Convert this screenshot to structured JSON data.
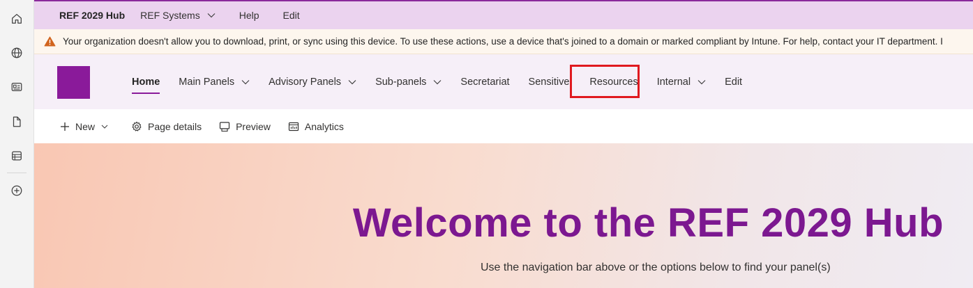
{
  "rail": {
    "icons": [
      "home-icon",
      "globe-icon",
      "news-icon",
      "document-icon",
      "list-icon",
      "add-icon"
    ]
  },
  "suite": {
    "site_title": "REF 2029 Hub",
    "items": [
      {
        "label": "REF Systems",
        "has_dropdown": true
      },
      {
        "label": "Help",
        "has_dropdown": false
      },
      {
        "label": "Edit",
        "has_dropdown": false
      }
    ]
  },
  "warning": {
    "text": "Your organization doesn't allow you to download, print, or sync using this device. To use these actions, use a device that's joined to a domain or marked compliant by Intune. For help, contact your IT department. I"
  },
  "nav": {
    "items": [
      {
        "label": "Home",
        "active": true
      },
      {
        "label": "Main Panels",
        "dropdown": true
      },
      {
        "label": "Advisory Panels",
        "dropdown": true
      },
      {
        "label": "Sub-panels",
        "dropdown": true
      },
      {
        "label": "Secretariat"
      },
      {
        "label": "Sensitive"
      },
      {
        "label": "Resources",
        "highlighted": true
      },
      {
        "label": "Internal",
        "dropdown": true
      },
      {
        "label": "Edit"
      }
    ]
  },
  "cmdbar": {
    "new_label": "New",
    "page_details_label": "Page details",
    "preview_label": "Preview",
    "analytics_label": "Analytics"
  },
  "hero": {
    "title": "Welcome to the REF 2029 Hub",
    "subtitle": "Use the navigation bar above or the options below to find your panel(s)"
  },
  "colors": {
    "brand": "#8a1a9a",
    "suite_bar": "#ebd3ef",
    "highlight_box": "#e0191f",
    "warning_icon": "#d1641e"
  }
}
